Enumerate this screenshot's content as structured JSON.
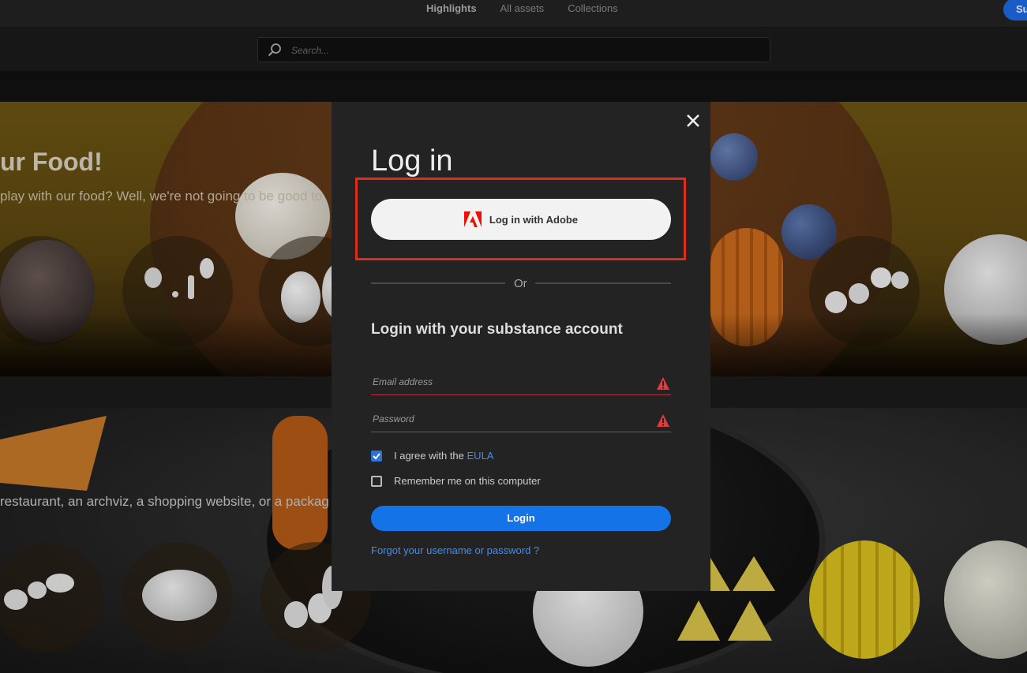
{
  "nav": {
    "tabs": [
      {
        "label": "Highlights",
        "active": true
      },
      {
        "label": "All assets",
        "active": false
      },
      {
        "label": "Collections",
        "active": false
      }
    ],
    "cta_label": "Su"
  },
  "search": {
    "placeholder": "Search...",
    "icon": "search-icon"
  },
  "hero1": {
    "title": "ur Food!",
    "subtitle": "play with our food? Well, we're not going to be good to"
  },
  "hero2": {
    "subtitle": "restaurant, an archviz, a shopping website, or a packag"
  },
  "modal": {
    "title": "Log in",
    "adobe_button_label": "Log in with Adobe",
    "or_text": "Or",
    "subtitle": "Login with your substance account",
    "email_placeholder": "Email address",
    "password_placeholder": "Password",
    "eula_prefix": "I agree with the",
    "eula_link": "EULA",
    "eula_checked": true,
    "remember_label": "Remember me on this computer",
    "remember_checked": false,
    "login_button_label": "Login",
    "forgot_link": "Forgot your username or password ?"
  },
  "colors": {
    "accent_blue": "#1473e6",
    "link_blue": "#3f8ff0",
    "error_red": "#e03a3a",
    "highlight_red": "#e22b18",
    "adobe_red": "#eb1000"
  }
}
